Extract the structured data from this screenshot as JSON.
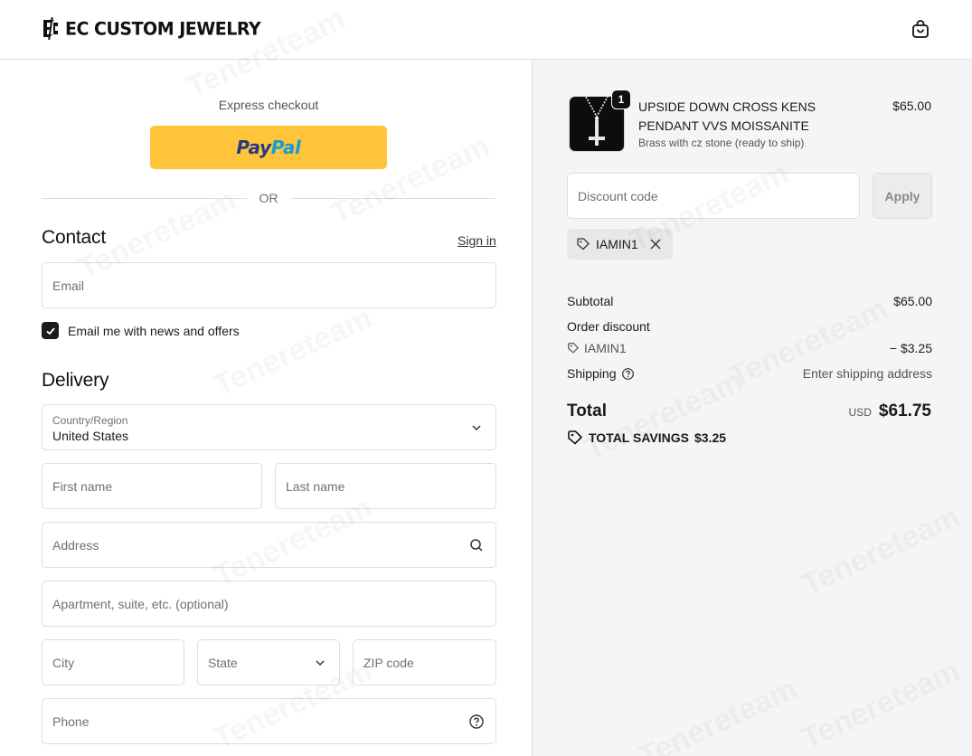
{
  "brand": {
    "name": "EC CUSTOM JEWELRY"
  },
  "watermark": "Tenereteam",
  "express": {
    "label": "Express checkout",
    "paypal_pay": "Pay",
    "paypal_pal": "Pal"
  },
  "divider": "OR",
  "contact": {
    "title": "Contact",
    "signin": "Sign in",
    "email_placeholder": "Email",
    "newsletter_label": "Email me with news and offers",
    "newsletter_checked": true
  },
  "delivery": {
    "title": "Delivery",
    "country_label": "Country/Region",
    "country_value": "United States",
    "first_name": "First name",
    "last_name": "Last name",
    "address": "Address",
    "apartment": "Apartment, suite, etc. (optional)",
    "city": "City",
    "state": "State",
    "zip": "ZIP code",
    "phone": "Phone"
  },
  "cart": {
    "item": {
      "name": "UPSIDE DOWN CROSS KENS PENDANT VVS MOISSANITE",
      "variant": "Brass with cz stone (ready to ship)",
      "price": "$65.00",
      "quantity": "1"
    },
    "discount_placeholder": "Discount code",
    "apply_label": "Apply",
    "applied_code": "IAMIN1"
  },
  "summary": {
    "subtotal_label": "Subtotal",
    "subtotal_value": "$65.00",
    "discount_label": "Order discount",
    "discount_code": "IAMIN1",
    "discount_value": "− $3.25",
    "shipping_label": "Shipping",
    "shipping_value": "Enter shipping address",
    "total_label": "Total",
    "total_currency": "USD",
    "total_value": "$61.75",
    "savings_label": "TOTAL SAVINGS",
    "savings_value": "$3.25"
  },
  "colors": {
    "paypal": "#ffc439",
    "sidebar_bg": "#f5f5f5",
    "border": "#dedede"
  }
}
